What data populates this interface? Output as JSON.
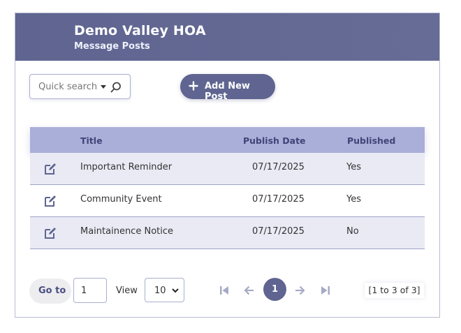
{
  "header": {
    "title": "Demo Valley HOA",
    "subtitle": "Message Posts"
  },
  "toolbar": {
    "search_placeholder": "Quick search",
    "search_icon": "search-icon",
    "add_button_label": "Add New Post",
    "add_icon": "plus-icon"
  },
  "table": {
    "columns": [
      "Title",
      "Publish Date",
      "Published"
    ],
    "rows": [
      {
        "title": "Important Reminder",
        "publish_date": "07/17/2025",
        "published": "Yes"
      },
      {
        "title": "Community Event",
        "publish_date": "07/17/2025",
        "published": "Yes"
      },
      {
        "title": "Maintainence Notice",
        "publish_date": "07/17/2025",
        "published": "No"
      }
    ],
    "row_action_icon": "edit-icon"
  },
  "pager": {
    "goto_label": "Go to",
    "goto_value": "1",
    "view_label": "View",
    "page_size": "10",
    "current_page": "1",
    "summary": "[1 to 3 of 3]",
    "nav_icons": [
      "first-page-icon",
      "prev-page-icon",
      "next-page-icon",
      "last-page-icon"
    ]
  },
  "colors": {
    "accent": "#5f6590",
    "table_header": "#a9afd8",
    "row_alt": "#e9eaf4",
    "header_text": "#3f4478",
    "disabled_nav": "#a7aac4"
  }
}
